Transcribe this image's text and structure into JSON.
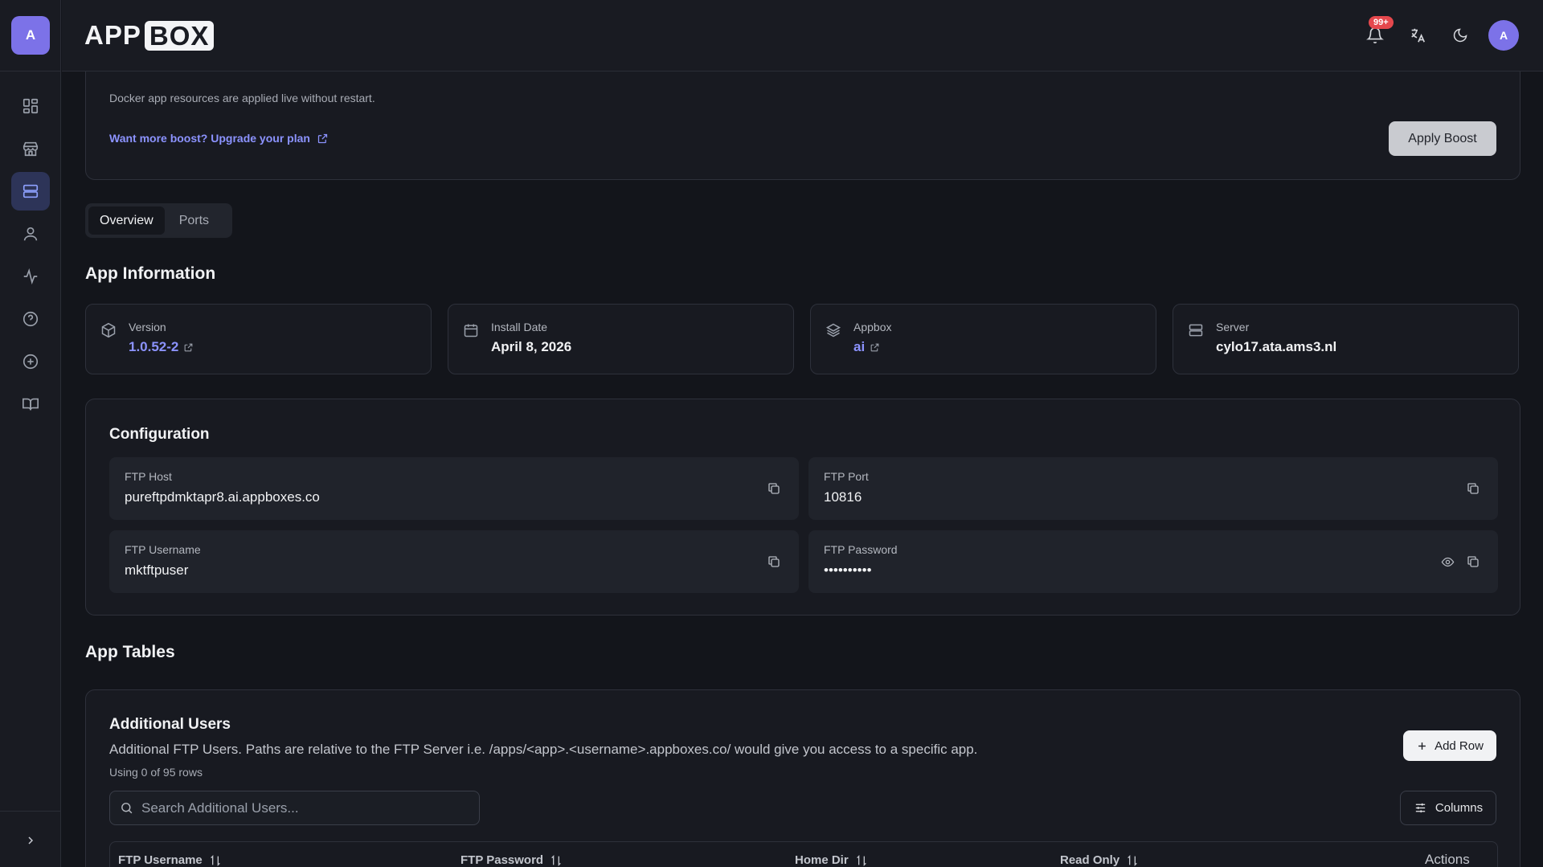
{
  "sidebar": {
    "logo_letter": "A",
    "items": [
      {
        "name": "dashboard-icon"
      },
      {
        "name": "store-icon"
      },
      {
        "name": "server-icon",
        "active": true
      },
      {
        "name": "user-icon"
      },
      {
        "name": "activity-icon"
      },
      {
        "name": "help-icon"
      },
      {
        "name": "plus-circle-icon"
      },
      {
        "name": "book-icon"
      }
    ]
  },
  "header": {
    "brand_app": "APP",
    "brand_box": "BOX",
    "notification_count": "99+",
    "avatar_letter": "A"
  },
  "boost": {
    "note": "Docker app resources are applied live without restart.",
    "upgrade_link": "Want more boost? Upgrade your plan",
    "apply_label": "Apply Boost"
  },
  "tabs": [
    {
      "label": "Overview",
      "active": true
    },
    {
      "label": "Ports",
      "active": false
    }
  ],
  "app_info": {
    "title": "App Information",
    "cards": [
      {
        "label": "Version",
        "value": "1.0.52-2",
        "link": true
      },
      {
        "label": "Install Date",
        "value": "April 8, 2026",
        "link": false
      },
      {
        "label": "Appbox",
        "value": "ai",
        "link": true
      },
      {
        "label": "Server",
        "value": "cylo17.ata.ams3.nl",
        "link": false
      }
    ]
  },
  "configuration": {
    "title": "Configuration",
    "fields": [
      {
        "label": "FTP Host",
        "value": "pureftpdmktapr8.ai.appboxes.co"
      },
      {
        "label": "FTP Port",
        "value": "10816"
      },
      {
        "label": "FTP Username",
        "value": "mktftpuser"
      },
      {
        "label": "FTP Password",
        "value": "••••••••••"
      }
    ]
  },
  "app_tables": {
    "title": "App Tables",
    "card_title": "Additional Users",
    "description": "Additional FTP Users. Paths are relative to the FTP Server i.e. /apps/<app>.<username>.appboxes.co/ would give you access to a specific app.",
    "usage": "Using 0 of 95 rows",
    "add_row_label": "Add Row",
    "search_placeholder": "Search Additional Users...",
    "columns_label": "Columns",
    "headers": [
      "FTP Username",
      "FTP Password",
      "Home Dir",
      "Read Only",
      "Actions"
    ]
  },
  "colors": {
    "accent": "#7c72e8",
    "link": "#8c93ff",
    "badge": "#e5484d"
  }
}
